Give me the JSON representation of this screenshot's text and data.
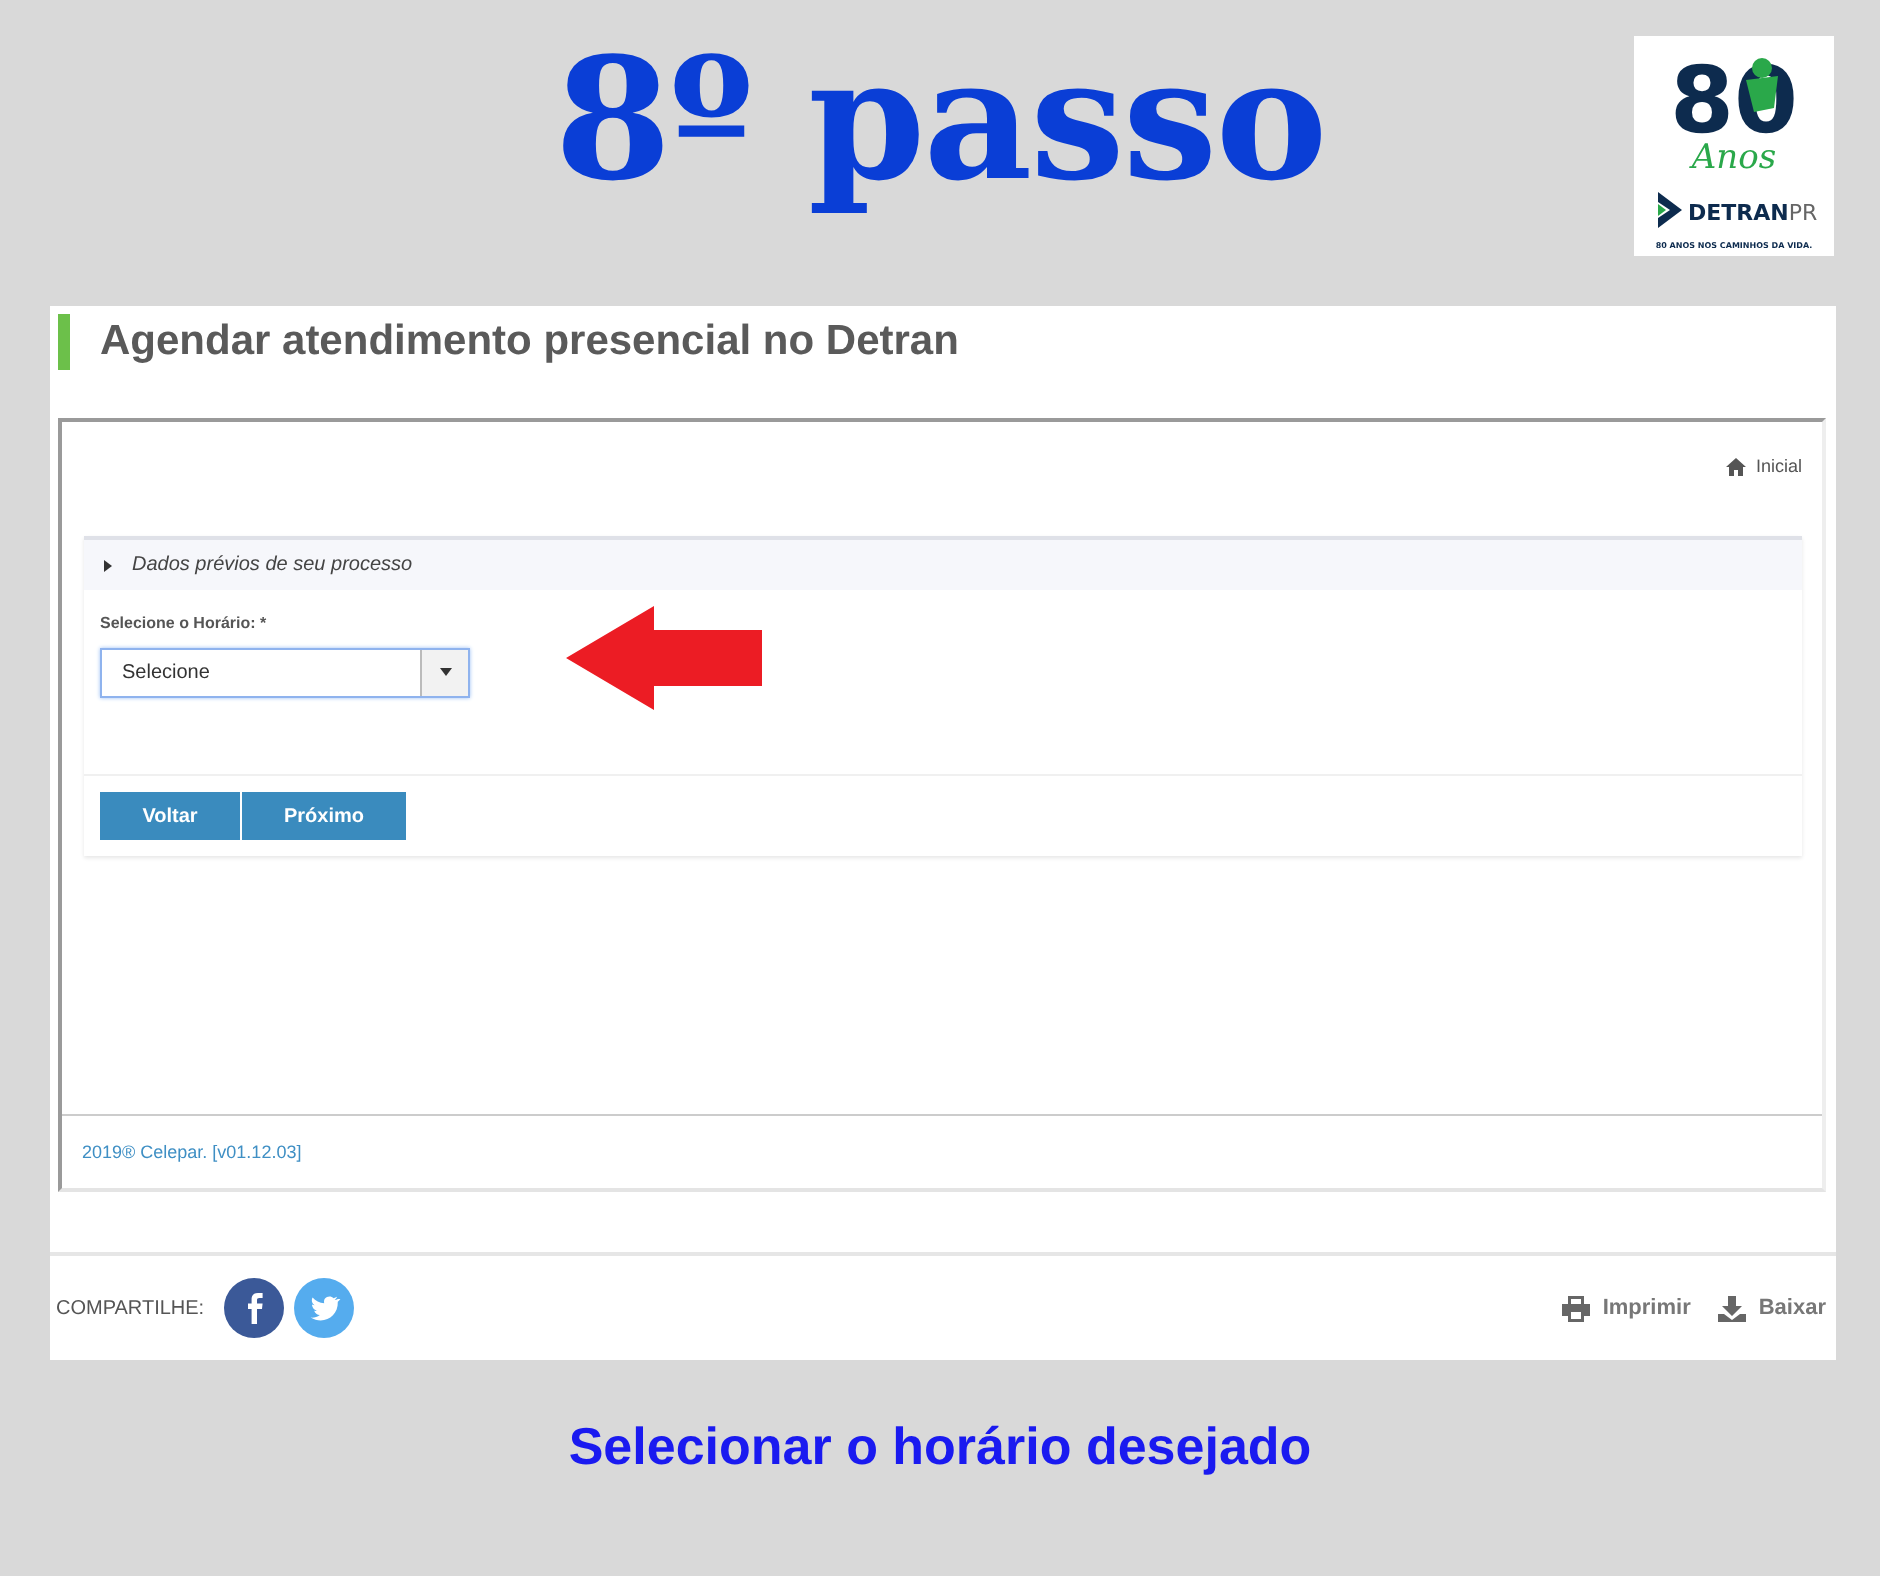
{
  "title": "8º passo",
  "logo": {
    "number": "80",
    "script": "Anos",
    "brand": "DETRAN",
    "brand_suffix": "PR",
    "tagline": "80 ANOS NOS CAMINHOS DA VIDA."
  },
  "screen": {
    "heading": "Agendar atendimento presencial no Detran",
    "breadcrumb": "Inicial",
    "section": {
      "title": "Dados prévios de seu processo",
      "expanded": false
    },
    "field": {
      "label": "Selecione o Horário: *",
      "value": "Selecione"
    },
    "buttons": [
      "Voltar",
      "Próximo"
    ],
    "footer": "2019® Celepar. [v01.12.03]",
    "share_label": "COMPARTILHE:",
    "actions": [
      {
        "kind": "print",
        "label": "Imprimir"
      },
      {
        "kind": "download",
        "label": "Baixar"
      }
    ]
  },
  "caption": "Selecionar o horário desejado"
}
